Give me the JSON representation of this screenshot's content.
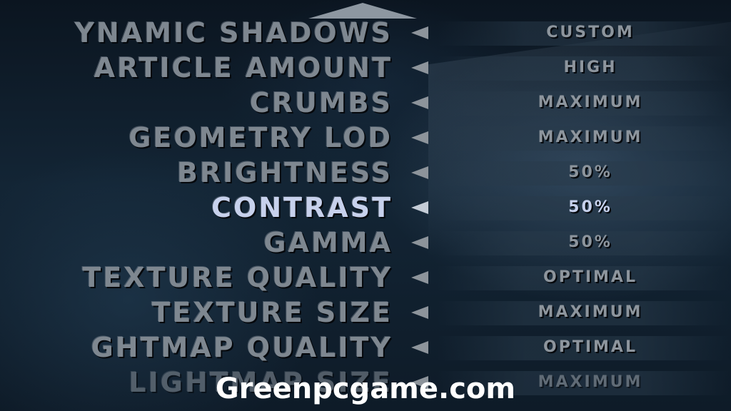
{
  "menu": {
    "items": [
      {
        "label": "YNAMIC SHADOWS",
        "value": "CUSTOM"
      },
      {
        "label": "ARTICLE AMOUNT",
        "value": "HIGH"
      },
      {
        "label": "CRUMBS",
        "value": "MAXIMUM"
      },
      {
        "label": "GEOMETRY LOD",
        "value": "MAXIMUM"
      },
      {
        "label": "BRIGHTNESS",
        "value": "50%"
      },
      {
        "label": "CONTRAST",
        "value": "50%"
      },
      {
        "label": "GAMMA",
        "value": "50%"
      },
      {
        "label": "TEXTURE QUALITY",
        "value": "OPTIMAL"
      },
      {
        "label": "TEXTURE SIZE",
        "value": "MAXIMUM"
      },
      {
        "label": "GHTMAP QUALITY",
        "value": "OPTIMAL"
      },
      {
        "label": "LIGHTMAP SIZE",
        "value": "MAXIMUM"
      }
    ],
    "selected_index": 5,
    "scroll_up_icon": "triangle-up-icon",
    "option_arrow_icon": "triangle-left-icon"
  },
  "watermark": "Greenpcgame.com",
  "colors": {
    "label": "#7e8790",
    "selected": "#c7d1ec",
    "background": "#0c1722",
    "watermark": "#ffffff"
  }
}
